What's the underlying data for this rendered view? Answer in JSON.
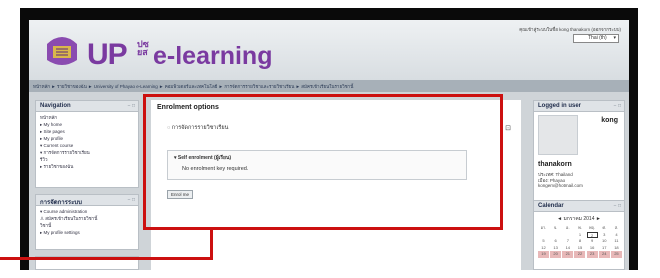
{
  "header": {
    "logo_main": "UP",
    "logo_sup": "ปซ\nยส",
    "logo_tail": "e-learning",
    "login_info": "คุณเข้าสู่ระบบในชื่อ kong thanakorn (ออกจากระบบ)",
    "language": "Thai (th)"
  },
  "breadcrumb": "หน้าหลัก ► รายวิชาของฉัน ► University of Phayao e-Learning ► คอมพิวเตอร์และเทคโนโลยี ► การจัดการรายวิชาและรายวิชาเรียน ► สมัครเข้าเรียนในรายวิชานี้",
  "navigation": {
    "title": "Navigation",
    "items": [
      "หน้าหลัก",
      "▸ My home",
      "▸ Site pages",
      "▸ My profile",
      "▾ Current course",
      "   ▾ การจัดการรายวิชาเรียน",
      "      รีวิว",
      "▸ รายวิชาของฉัน"
    ]
  },
  "admin": {
    "title": "การจัดการระบบ",
    "items": [
      "▾ Course administration",
      "   ♙ สมัครเข้าเรียนในรายวิชานี้",
      "      วิชานี้",
      "▸ My profile settings"
    ]
  },
  "enrol": {
    "title": "Enrolment options",
    "course": "การจัดการรายวิชาเรียน",
    "self_heading": "Self enrolment (ผู้เรียน)",
    "message": "No enrolment key required.",
    "button": "Enrol me"
  },
  "logged_in": {
    "title": "Logged in user",
    "username": "kong",
    "fullname": "thanakorn",
    "country": "ประเทศ: Thailand",
    "city": "เมือง: Phayao",
    "email": "kongem@hotmail.com"
  },
  "calendar": {
    "title": "Calendar",
    "month": "มกราคม 2014",
    "days": [
      "อา.",
      "จ.",
      "อ.",
      "พ.",
      "พฤ.",
      "ศ.",
      "ส."
    ],
    "weeks": [
      [
        "",
        "",
        "",
        "1",
        "2",
        "3",
        "4"
      ],
      [
        "5",
        "6",
        "7",
        "8",
        "9",
        "10",
        "11"
      ],
      [
        "12",
        "13",
        "14",
        "15",
        "16",
        "17",
        "18"
      ],
      [
        "19",
        "20",
        "21",
        "22",
        "23",
        "24",
        "25"
      ]
    ]
  },
  "colors": {
    "highlight": "#cc1010",
    "brand": "#7a3aa0"
  }
}
